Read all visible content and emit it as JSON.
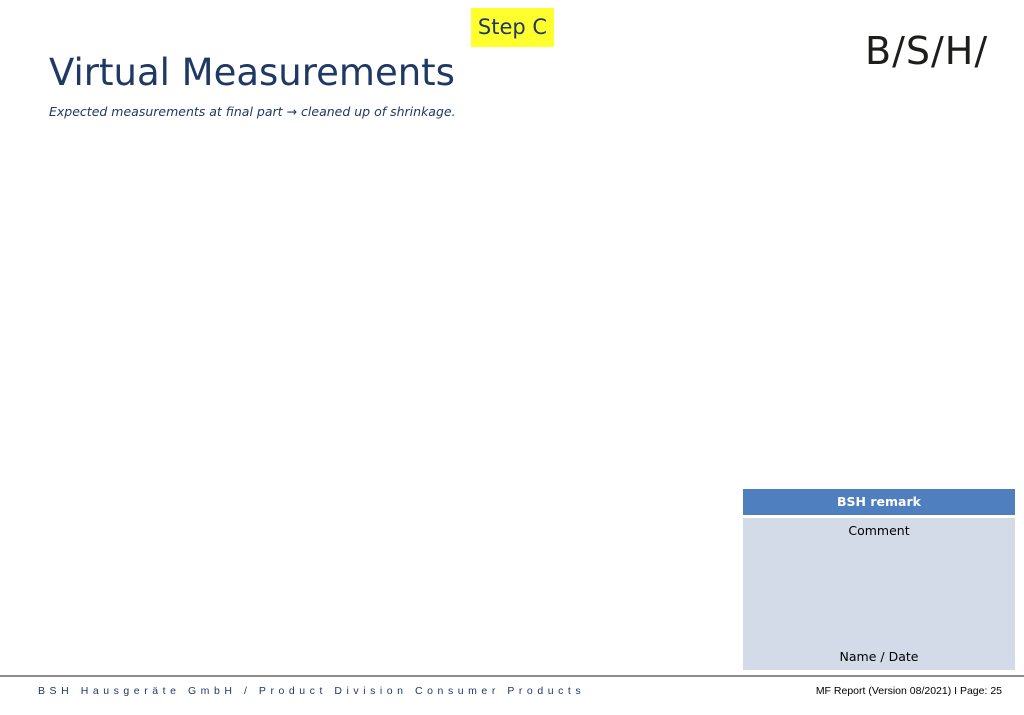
{
  "slide": {
    "step_badge": "Step C",
    "logo_text": "B/S/H/",
    "title": "Virtual Measurements",
    "subtitle_part1": "Expected measurements at final part",
    "subtitle_arrow": "→",
    "subtitle_part2": "cleaned up of shrinkage."
  },
  "remark": {
    "header": "BSH remark",
    "comment": "Comment",
    "name_date": "Name / Date"
  },
  "footer": {
    "company": "BSH Hausgeräte GmbH / Product Division Consumer Products",
    "report": "MF Report (Version 08/2021) I Page: 25"
  },
  "colors": {
    "badge_bg": "#ffff2e",
    "header_blue": "#4f7fbe",
    "body_light_blue": "#d3dbe9",
    "title_navy": "#1f3864"
  }
}
